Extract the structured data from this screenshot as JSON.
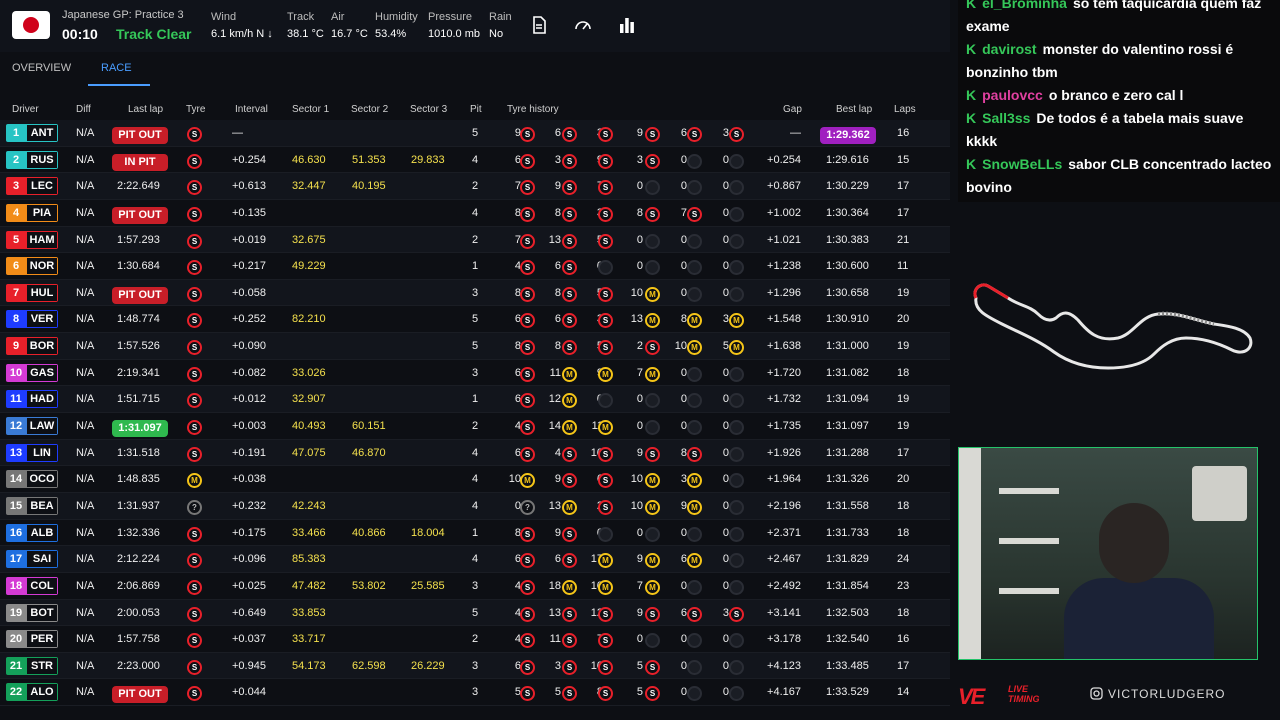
{
  "header": {
    "session": "Japanese GP: Practice 3",
    "time": "00:10",
    "track_status": "Track Clear",
    "weather": [
      {
        "label": "Wind",
        "value": "6.1 km/h N ↓"
      },
      {
        "label": "Track",
        "value": "38.1 °C"
      },
      {
        "label": "Air",
        "value": "16.7 °C"
      },
      {
        "label": "Humidity",
        "value": "53.4%"
      },
      {
        "label": "Pressure",
        "value": "1010.0 mb"
      },
      {
        "label": "Rain",
        "value": "No"
      }
    ],
    "icons": [
      "document-icon",
      "gauge-icon",
      "bar-chart-icon"
    ]
  },
  "tabs": [
    {
      "label": "OVERVIEW",
      "active": false
    },
    {
      "label": "RACE",
      "active": true
    }
  ],
  "columns": {
    "driver": "Driver",
    "diff": "Diff",
    "last_lap": "Last lap",
    "tyre": "Tyre",
    "interval": "Interval",
    "sector1": "Sector 1",
    "sector2": "Sector 2",
    "sector3": "Sector 3",
    "pit": "Pit",
    "tyre_history": "Tyre history",
    "gap": "Gap",
    "best_lap": "Best lap",
    "laps": "Laps"
  },
  "drivers": [
    {
      "pos": "1",
      "code": "ANT",
      "color": "#27c4c4",
      "diff": "N/A",
      "last": "PIT OUT",
      "last_style": "pit",
      "tyre": "S",
      "interval": "—",
      "s1": "",
      "s2": "",
      "s3": "",
      "pit": "5",
      "hist": [
        [
          "9",
          "S"
        ],
        [
          "6",
          "S"
        ],
        [
          "3",
          "S"
        ],
        [
          "9",
          "S"
        ],
        [
          "6",
          "S"
        ],
        [
          "3",
          "S"
        ]
      ],
      "gap": "—",
      "best": "1:29.362",
      "best_hl": true,
      "laps": "16"
    },
    {
      "pos": "2",
      "code": "RUS",
      "color": "#27c4c4",
      "diff": "N/A",
      "last": "IN PIT",
      "last_style": "pit",
      "tyre": "S",
      "interval": "+0.254",
      "s1": "46.630",
      "s2": "51.353",
      "s3": "29.833",
      "pit": "4",
      "hist": [
        [
          "6",
          "S"
        ],
        [
          "3",
          "S"
        ],
        [
          "9",
          "S"
        ],
        [
          "3",
          "S"
        ],
        [
          "0",
          "E"
        ],
        [
          "0",
          "E"
        ]
      ],
      "gap": "+0.254",
      "best": "1:29.616",
      "best_hl": false,
      "laps": "15"
    },
    {
      "pos": "3",
      "code": "LEC",
      "color": "#e8202a",
      "diff": "N/A",
      "last": "2:22.649",
      "last_style": "",
      "tyre": "S",
      "interval": "+0.613",
      "s1": "32.447",
      "s2": "40.195",
      "s3": "",
      "pit": "2",
      "hist": [
        [
          "7",
          "S"
        ],
        [
          "9",
          "S"
        ],
        [
          "7",
          "S"
        ],
        [
          "0",
          "E"
        ],
        [
          "0",
          "E"
        ],
        [
          "0",
          "E"
        ]
      ],
      "gap": "+0.867",
      "best": "1:30.229",
      "best_hl": false,
      "laps": "17"
    },
    {
      "pos": "4",
      "code": "PIA",
      "color": "#f28c18",
      "diff": "N/A",
      "last": "PIT OUT",
      "last_style": "pit",
      "tyre": "S",
      "interval": "+0.135",
      "s1": "",
      "s2": "",
      "s3": "",
      "pit": "4",
      "hist": [
        [
          "8",
          "S"
        ],
        [
          "8",
          "S"
        ],
        [
          "3",
          "S"
        ],
        [
          "8",
          "S"
        ],
        [
          "7",
          "S"
        ],
        [
          "0",
          "E"
        ]
      ],
      "gap": "+1.002",
      "best": "1:30.364",
      "best_hl": false,
      "laps": "17"
    },
    {
      "pos": "5",
      "code": "HAM",
      "color": "#e8202a",
      "diff": "N/A",
      "last": "1:57.293",
      "last_style": "",
      "tyre": "S",
      "interval": "+0.019",
      "s1": "32.675",
      "s2": "",
      "s3": "",
      "pit": "2",
      "hist": [
        [
          "7",
          "S"
        ],
        [
          "13",
          "S"
        ],
        [
          "5",
          "S"
        ],
        [
          "0",
          "E"
        ],
        [
          "0",
          "E"
        ],
        [
          "0",
          "E"
        ]
      ],
      "gap": "+1.021",
      "best": "1:30.383",
      "best_hl": false,
      "laps": "21"
    },
    {
      "pos": "6",
      "code": "NOR",
      "color": "#f28c18",
      "diff": "N/A",
      "last": "1:30.684",
      "last_style": "",
      "tyre": "S",
      "interval": "+0.217",
      "s1": "49.229",
      "s2": "",
      "s3": "",
      "pit": "1",
      "hist": [
        [
          "4",
          "S"
        ],
        [
          "6",
          "S"
        ],
        [
          "0",
          "E"
        ],
        [
          "0",
          "E"
        ],
        [
          "0",
          "E"
        ],
        [
          "0",
          "E"
        ]
      ],
      "gap": "+1.238",
      "best": "1:30.600",
      "best_hl": false,
      "laps": "11"
    },
    {
      "pos": "7",
      "code": "HUL",
      "color": "#e8202a",
      "diff": "N/A",
      "last": "PIT OUT",
      "last_style": "pit",
      "tyre": "S",
      "interval": "+0.058",
      "s1": "",
      "s2": "",
      "s3": "",
      "pit": "3",
      "hist": [
        [
          "8",
          "S"
        ],
        [
          "8",
          "S"
        ],
        [
          "5",
          "S"
        ],
        [
          "10",
          "M"
        ],
        [
          "0",
          "E"
        ],
        [
          "0",
          "E"
        ]
      ],
      "gap": "+1.296",
      "best": "1:30.658",
      "best_hl": false,
      "laps": "19"
    },
    {
      "pos": "8",
      "code": "VER",
      "color": "#1e3cff",
      "diff": "N/A",
      "last": "1:48.774",
      "last_style": "",
      "tyre": "S",
      "interval": "+0.252",
      "s1": "82.210",
      "s2": "",
      "s3": "",
      "pit": "5",
      "hist": [
        [
          "6",
          "S"
        ],
        [
          "6",
          "S"
        ],
        [
          "3",
          "S"
        ],
        [
          "13",
          "M"
        ],
        [
          "8",
          "M"
        ],
        [
          "3",
          "M"
        ]
      ],
      "gap": "+1.548",
      "best": "1:30.910",
      "best_hl": false,
      "laps": "20"
    },
    {
      "pos": "9",
      "code": "BOR",
      "color": "#e8202a",
      "diff": "N/A",
      "last": "1:57.526",
      "last_style": "",
      "tyre": "S",
      "interval": "+0.090",
      "s1": "",
      "s2": "",
      "s3": "",
      "pit": "5",
      "hist": [
        [
          "8",
          "S"
        ],
        [
          "8",
          "S"
        ],
        [
          "5",
          "S"
        ],
        [
          "2",
          "S"
        ],
        [
          "10",
          "M"
        ],
        [
          "5",
          "M"
        ]
      ],
      "gap": "+1.638",
      "best": "1:31.000",
      "best_hl": false,
      "laps": "19"
    },
    {
      "pos": "10",
      "code": "GAS",
      "color": "#d43ad4",
      "diff": "N/A",
      "last": "2:19.341",
      "last_style": "",
      "tyre": "S",
      "interval": "+0.082",
      "s1": "33.026",
      "s2": "",
      "s3": "",
      "pit": "3",
      "hist": [
        [
          "6",
          "S"
        ],
        [
          "11",
          "M"
        ],
        [
          "9",
          "M"
        ],
        [
          "7",
          "M"
        ],
        [
          "0",
          "E"
        ],
        [
          "0",
          "E"
        ]
      ],
      "gap": "+1.720",
      "best": "1:31.082",
      "best_hl": false,
      "laps": "18"
    },
    {
      "pos": "11",
      "code": "HAD",
      "color": "#1e3cff",
      "diff": "N/A",
      "last": "1:51.715",
      "last_style": "",
      "tyre": "S",
      "interval": "+0.012",
      "s1": "32.907",
      "s2": "",
      "s3": "",
      "pit": "1",
      "hist": [
        [
          "6",
          "S"
        ],
        [
          "12",
          "M"
        ],
        [
          "0",
          "E"
        ],
        [
          "0",
          "E"
        ],
        [
          "0",
          "E"
        ],
        [
          "0",
          "E"
        ]
      ],
      "gap": "+1.732",
      "best": "1:31.094",
      "best_hl": false,
      "laps": "19"
    },
    {
      "pos": "12",
      "code": "LAW",
      "color": "#3a7bd5",
      "diff": "N/A",
      "last": "1:31.097",
      "last_style": "green",
      "tyre": "S",
      "interval": "+0.003",
      "s1": "40.493",
      "s2": "60.151",
      "s3": "",
      "pit": "2",
      "hist": [
        [
          "4",
          "S"
        ],
        [
          "14",
          "M"
        ],
        [
          "11",
          "M"
        ],
        [
          "0",
          "E"
        ],
        [
          "0",
          "E"
        ],
        [
          "0",
          "E"
        ]
      ],
      "gap": "+1.735",
      "best": "1:31.097",
      "best_hl": false,
      "laps": "19"
    },
    {
      "pos": "13",
      "code": "LIN",
      "color": "#1e3cff",
      "diff": "N/A",
      "last": "1:31.518",
      "last_style": "",
      "tyre": "S",
      "interval": "+0.191",
      "s1": "47.075",
      "s2": "46.870",
      "s3": "",
      "pit": "4",
      "hist": [
        [
          "6",
          "S"
        ],
        [
          "4",
          "S"
        ],
        [
          "10",
          "S"
        ],
        [
          "9",
          "S"
        ],
        [
          "8",
          "S"
        ],
        [
          "0",
          "E"
        ]
      ],
      "gap": "+1.926",
      "best": "1:31.288",
      "best_hl": false,
      "laps": "17"
    },
    {
      "pos": "14",
      "code": "OCO",
      "color": "#777777",
      "diff": "N/A",
      "last": "1:48.835",
      "last_style": "",
      "tyre": "M",
      "interval": "+0.038",
      "s1": "",
      "s2": "",
      "s3": "",
      "pit": "4",
      "hist": [
        [
          "10",
          "M"
        ],
        [
          "9",
          "S"
        ],
        [
          "6",
          "S"
        ],
        [
          "10",
          "M"
        ],
        [
          "3",
          "M"
        ],
        [
          "0",
          "E"
        ]
      ],
      "gap": "+1.964",
      "best": "1:31.326",
      "best_hl": false,
      "laps": "20"
    },
    {
      "pos": "15",
      "code": "BEA",
      "color": "#777777",
      "diff": "N/A",
      "last": "1:31.937",
      "last_style": "",
      "tyre": "U",
      "interval": "+0.232",
      "s1": "42.243",
      "s2": "",
      "s3": "",
      "pit": "4",
      "hist": [
        [
          "0",
          "U"
        ],
        [
          "13",
          "M"
        ],
        [
          "2",
          "S"
        ],
        [
          "10",
          "M"
        ],
        [
          "9",
          "M"
        ],
        [
          "0",
          "E"
        ]
      ],
      "gap": "+2.196",
      "best": "1:31.558",
      "best_hl": false,
      "laps": "18"
    },
    {
      "pos": "16",
      "code": "ALB",
      "color": "#1e6fe0",
      "diff": "N/A",
      "last": "1:32.336",
      "last_style": "",
      "tyre": "S",
      "interval": "+0.175",
      "s1": "33.466",
      "s2": "40.866",
      "s3": "18.004",
      "pit": "1",
      "hist": [
        [
          "8",
          "S"
        ],
        [
          "9",
          "S"
        ],
        [
          "0",
          "E"
        ],
        [
          "0",
          "E"
        ],
        [
          "0",
          "E"
        ],
        [
          "0",
          "E"
        ]
      ],
      "gap": "+2.371",
      "best": "1:31.733",
      "best_hl": false,
      "laps": "18"
    },
    {
      "pos": "17",
      "code": "SAI",
      "color": "#1e6fe0",
      "diff": "N/A",
      "last": "2:12.224",
      "last_style": "",
      "tyre": "S",
      "interval": "+0.096",
      "s1": "85.383",
      "s2": "",
      "s3": "",
      "pit": "4",
      "hist": [
        [
          "6",
          "S"
        ],
        [
          "6",
          "S"
        ],
        [
          "17",
          "M"
        ],
        [
          "9",
          "M"
        ],
        [
          "6",
          "M"
        ],
        [
          "0",
          "E"
        ]
      ],
      "gap": "+2.467",
      "best": "1:31.829",
      "best_hl": false,
      "laps": "24"
    },
    {
      "pos": "18",
      "code": "COL",
      "color": "#d43ad4",
      "diff": "N/A",
      "last": "2:06.869",
      "last_style": "",
      "tyre": "S",
      "interval": "+0.025",
      "s1": "47.482",
      "s2": "53.802",
      "s3": "25.585",
      "pit": "3",
      "hist": [
        [
          "4",
          "S"
        ],
        [
          "18",
          "M"
        ],
        [
          "10",
          "M"
        ],
        [
          "7",
          "M"
        ],
        [
          "0",
          "E"
        ],
        [
          "0",
          "E"
        ]
      ],
      "gap": "+2.492",
      "best": "1:31.854",
      "best_hl": false,
      "laps": "23"
    },
    {
      "pos": "19",
      "code": "BOT",
      "color": "#8a8a8a",
      "diff": "N/A",
      "last": "2:00.053",
      "last_style": "",
      "tyre": "S",
      "interval": "+0.649",
      "s1": "33.853",
      "s2": "",
      "s3": "",
      "pit": "5",
      "hist": [
        [
          "4",
          "S"
        ],
        [
          "13",
          "S"
        ],
        [
          "12",
          "S"
        ],
        [
          "9",
          "S"
        ],
        [
          "6",
          "S"
        ],
        [
          "3",
          "S"
        ]
      ],
      "gap": "+3.141",
      "best": "1:32.503",
      "best_hl": false,
      "laps": "18"
    },
    {
      "pos": "20",
      "code": "PER",
      "color": "#8a8a8a",
      "diff": "N/A",
      "last": "1:57.758",
      "last_style": "",
      "tyre": "S",
      "interval": "+0.037",
      "s1": "33.717",
      "s2": "",
      "s3": "",
      "pit": "2",
      "hist": [
        [
          "4",
          "S"
        ],
        [
          "11",
          "S"
        ],
        [
          "7",
          "S"
        ],
        [
          "0",
          "E"
        ],
        [
          "0",
          "E"
        ],
        [
          "0",
          "E"
        ]
      ],
      "gap": "+3.178",
      "best": "1:32.540",
      "best_hl": false,
      "laps": "16"
    },
    {
      "pos": "21",
      "code": "STR",
      "color": "#14a05a",
      "diff": "N/A",
      "last": "2:23.000",
      "last_style": "",
      "tyre": "S",
      "interval": "+0.945",
      "s1": "54.173",
      "s2": "62.598",
      "s3": "26.229",
      "pit": "3",
      "hist": [
        [
          "6",
          "S"
        ],
        [
          "3",
          "S"
        ],
        [
          "10",
          "S"
        ],
        [
          "5",
          "S"
        ],
        [
          "0",
          "E"
        ],
        [
          "0",
          "E"
        ]
      ],
      "gap": "+4.123",
      "best": "1:33.485",
      "best_hl": false,
      "laps": "17"
    },
    {
      "pos": "22",
      "code": "ALO",
      "color": "#14a05a",
      "diff": "N/A",
      "last": "PIT OUT",
      "last_style": "pit",
      "tyre": "S",
      "interval": "+0.044",
      "s1": "",
      "s2": "",
      "s3": "",
      "pit": "3",
      "hist": [
        [
          "5",
          "S"
        ],
        [
          "5",
          "S"
        ],
        [
          "8",
          "S"
        ],
        [
          "5",
          "S"
        ],
        [
          "0",
          "E"
        ],
        [
          "0",
          "E"
        ]
      ],
      "gap": "+4.167",
      "best": "1:33.529",
      "best_hl": false,
      "laps": "14"
    }
  ],
  "chat": [
    {
      "user": "el_Brominha",
      "color": "#35c759",
      "text": "so tem taquicardia quem faz exame"
    },
    {
      "user": "davirost",
      "color": "#35c759",
      "text": "monster do valentino rossi é bonzinho tbm"
    },
    {
      "user": "paulovcc",
      "color": "#e040a0",
      "text": "o branco e zero cal l"
    },
    {
      "user": "Sall3ss",
      "color": "#35c759",
      "text": "De todos é a tabela mais suave kkkk"
    },
    {
      "user": "SnowBeLLs",
      "color": "#35c759",
      "text": "sabor CLB concentrado lacteo bovino"
    }
  ],
  "brand": {
    "logo_text_1": "LIVE",
    "logo_text_2": "TIMING",
    "handle": "VICTORLUDGERO"
  },
  "tyre_labels": {
    "S": "S",
    "M": "M",
    "U": "?",
    "E": ""
  }
}
